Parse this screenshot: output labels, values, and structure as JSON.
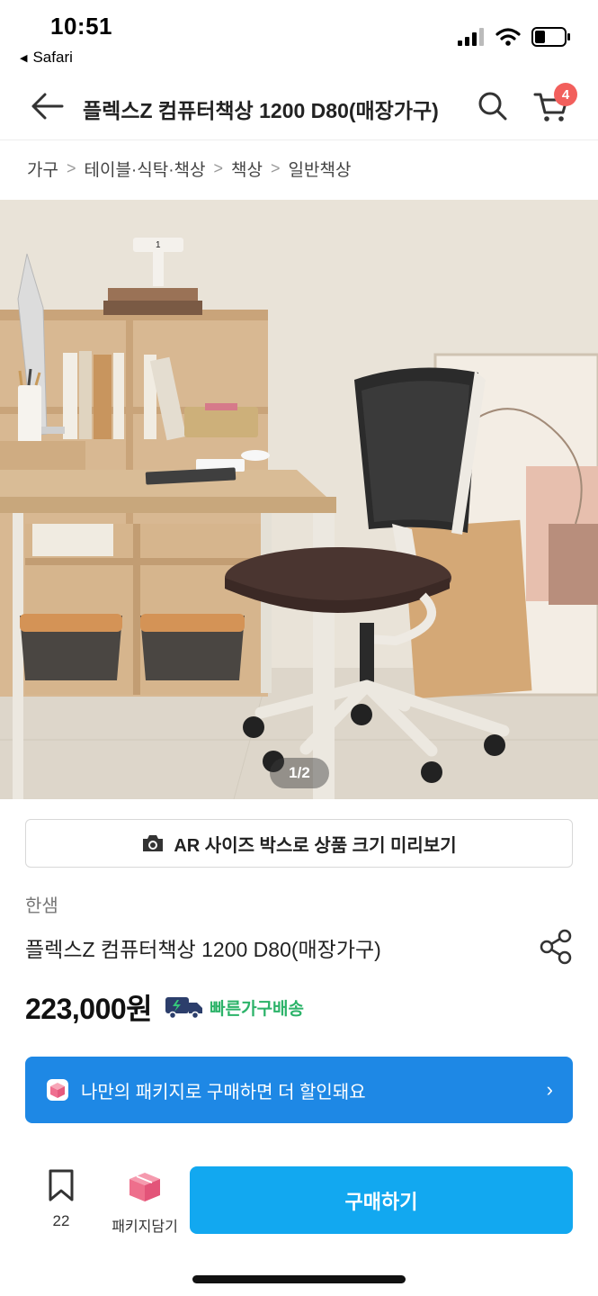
{
  "status_bar": {
    "time": "10:51",
    "back_app": "Safari"
  },
  "header": {
    "title": "플렉스Z 컴퓨터책상 1200 D80(매장가구)",
    "cart_count": "4"
  },
  "breadcrumb": [
    "가구",
    "테이블·식탁·책상",
    "책상",
    "일반책상"
  ],
  "hero": {
    "counter": "1/2"
  },
  "ar_button": {
    "label": "AR 사이즈 박스로 상품 크기 미리보기"
  },
  "product": {
    "brand": "한샘",
    "name": "플렉스Z 컴퓨터책상 1200 D80(매장가구)",
    "price": "223,000원",
    "delivery_label": "빠른가구배송"
  },
  "package_banner": {
    "text": "나만의 패키지로 구매하면 더 할인돼요",
    "chevron": "›"
  },
  "bottom_bar": {
    "bookmark_count": "22",
    "package_add_label": "패키지담기",
    "buy_label": "구매하기"
  },
  "colors": {
    "accent_blue": "#12a8f0",
    "banner_blue": "#1e88e5",
    "badge_red": "#f25f5c",
    "delivery_green": "#2cb369"
  }
}
